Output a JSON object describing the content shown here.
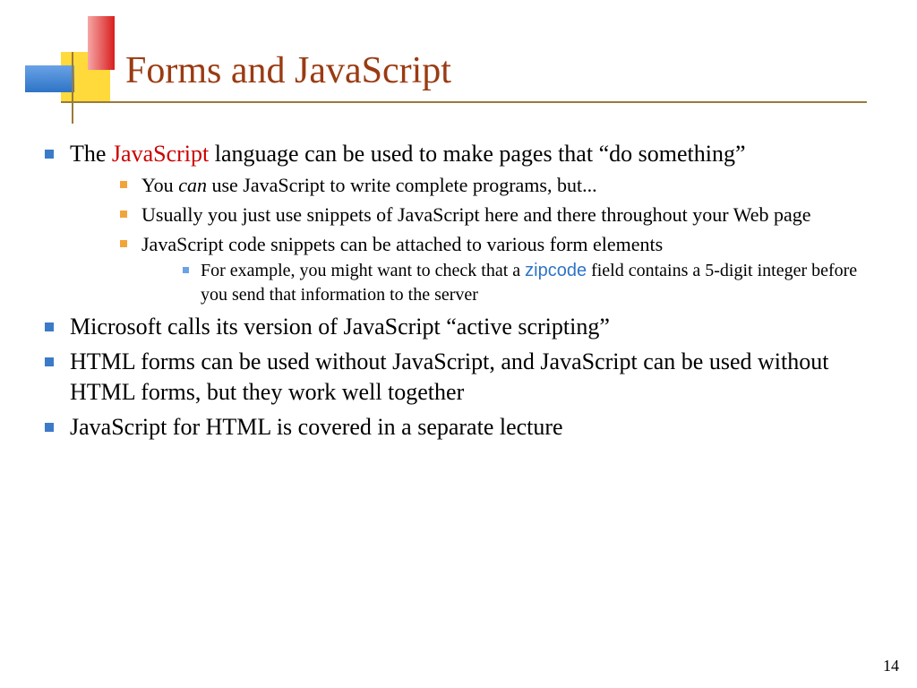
{
  "title": "Forms and JavaScript",
  "page_number": "14",
  "bullets": {
    "b0": {
      "pre": "The ",
      "js": "JavaScript",
      "post": " language can be used to make pages that “do something”"
    },
    "b0_sub": {
      "s0_pre": "You ",
      "s0_em": "can",
      "s0_post": " use JavaScript to write complete programs, but...",
      "s1": "Usually you just use snippets of JavaScript here and there throughout your Web page",
      "s2": "JavaScript code snippets can be attached to various form elements",
      "s2_sub_pre": "For example, you might want to check that a ",
      "s2_sub_code": "zipcode",
      "s2_sub_post": " field contains a 5-digit integer before you send that information to the server"
    },
    "b1": "Microsoft calls its version of JavaScript “active scripting”",
    "b2": "HTML forms can be used without JavaScript, and JavaScript can be used without HTML forms, but they work well together",
    "b3": "JavaScript for HTML is covered in a separate lecture"
  }
}
